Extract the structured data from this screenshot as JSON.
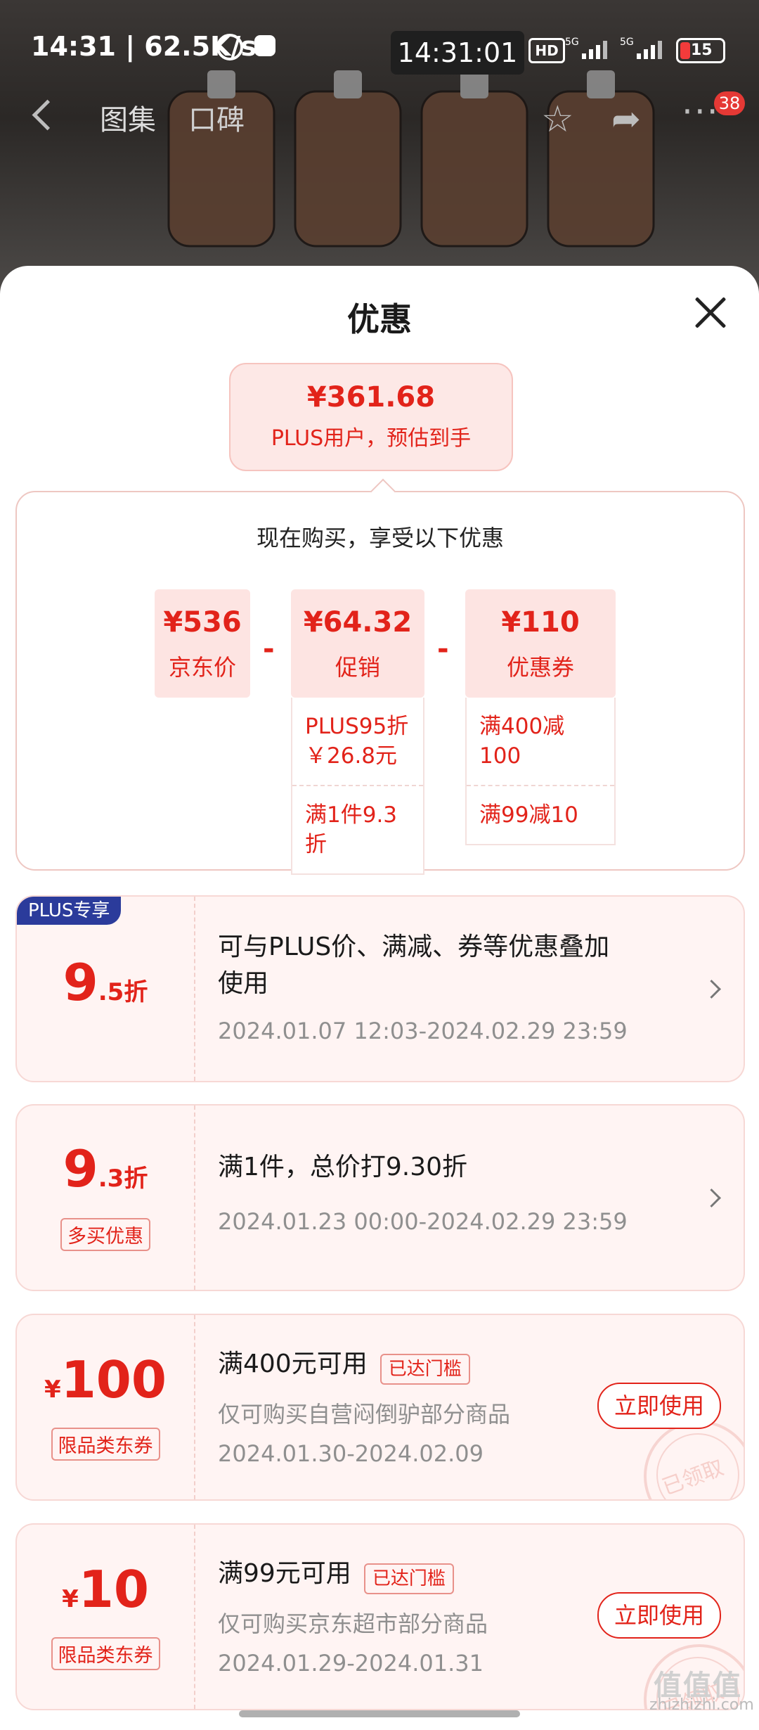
{
  "status_bar": {
    "time_speed": "14:31 | 62.5K/s",
    "clock": "14:31:01",
    "hd_label": "HD",
    "network_1": "5G",
    "network_2": "5G",
    "battery": "15"
  },
  "nav": {
    "tabs": [
      "图集",
      "口碑"
    ],
    "badge": "38"
  },
  "sheet": {
    "title": "优惠",
    "final_price": "¥361.68",
    "final_price_label": "PLUS用户，预估到手",
    "calc_head": "现在购买，享受以下优惠",
    "cells": [
      {
        "value": "¥536",
        "label": "京东价"
      },
      {
        "value": "¥64.32",
        "label": "促销"
      },
      {
        "value": "¥110",
        "label": "优惠券"
      }
    ],
    "minus": "-",
    "promo_details": [
      "PLUS95折\n￥26.8元",
      "满1件9.3折"
    ],
    "coupon_details": [
      "满400减100",
      "满99减10"
    ]
  },
  "cards": [
    {
      "tag": "PLUS专享",
      "num": "9",
      "suffix": ".5折",
      "title": "可与PLUS价、满减、券等优惠叠加使用",
      "date": "2024.01.07 12:03-2024.02.29 23:59"
    },
    {
      "num": "9",
      "suffix": ".3折",
      "label": "多买优惠",
      "title": "满1件，总价打9.30折",
      "date": "2024.01.23 00:00-2024.02.29 23:59"
    },
    {
      "currency": "¥",
      "amount": "100",
      "label": "限品类东券",
      "title": "满400元可用",
      "threshold": "已达门槛",
      "scope": "仅可购买自营闷倒驴部分商品",
      "date": "2024.01.30-2024.02.09",
      "button": "立即使用",
      "stamp": "已领取"
    },
    {
      "currency": "¥",
      "amount": "10",
      "label": "限品类东券",
      "title": "满99元可用",
      "threshold": "已达门槛",
      "scope": "仅可购买京东超市部分商品",
      "date": "2024.01.29-2024.01.31",
      "button": "立即使用",
      "stamp": "已领取"
    }
  ],
  "watermark": {
    "logo": "值值值",
    "url": "zhizhizhi.com"
  }
}
